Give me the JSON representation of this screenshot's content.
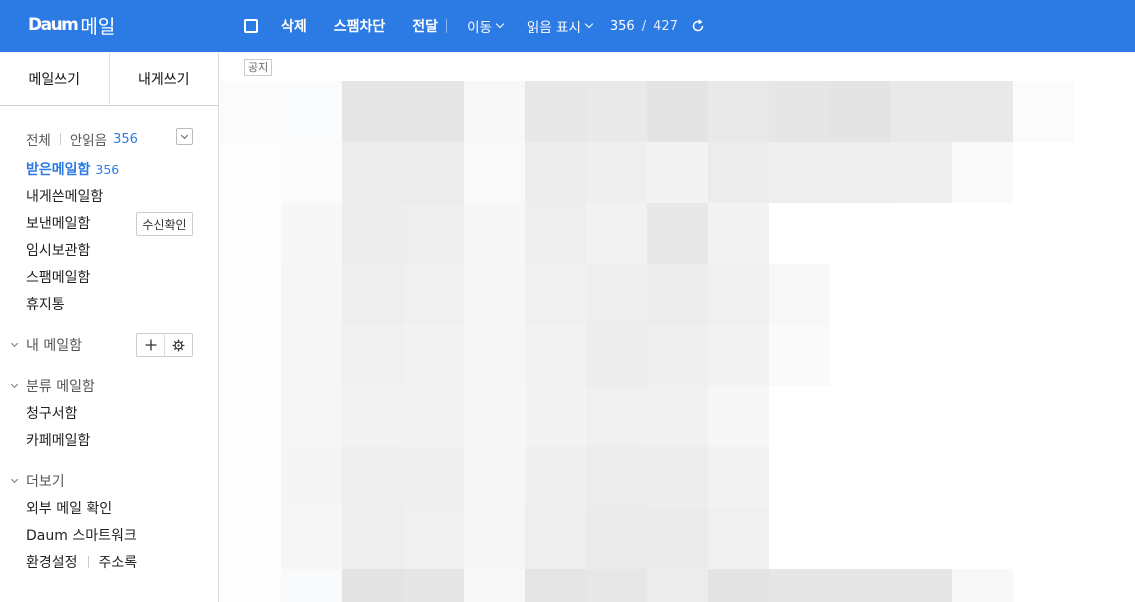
{
  "header": {
    "logo_mark": "Daum",
    "logo_text": "메일",
    "toolbar": {
      "delete_label": "삭제",
      "spam_label": "스팸차단",
      "forward_label": "전달",
      "move_label": "이동",
      "read_mark_label": "읽음 표시",
      "unread_count": "356",
      "count_sep": "/",
      "total_count": "427"
    }
  },
  "sidebar": {
    "write_mail": "메일쓰기",
    "write_to_me": "내게쓰기",
    "filter": {
      "all": "전체",
      "unread": "안읽음",
      "unread_count": "356"
    },
    "folders": [
      {
        "label": "받은메일함",
        "count": "356"
      },
      {
        "label": "내게쓴메일함"
      },
      {
        "label": "보낸메일함"
      },
      {
        "label": "임시보관함"
      },
      {
        "label": "스팸메일함"
      },
      {
        "label": "휴지통"
      }
    ],
    "receipt_check": "수신확인",
    "my_mailbox": "내 메일함",
    "category_mailbox": "분류 메일함",
    "category_items": [
      "청구서함",
      "카페메일함"
    ],
    "more": "더보기",
    "more_items": [
      "외부 메일 확인",
      "Daum 스마트워크"
    ],
    "settings": "환경설정",
    "address_book": "주소록"
  },
  "main": {
    "notice_tag": "공지"
  },
  "colors": {
    "brand": "#2c7be5",
    "unread_count": "#2c7be5"
  }
}
